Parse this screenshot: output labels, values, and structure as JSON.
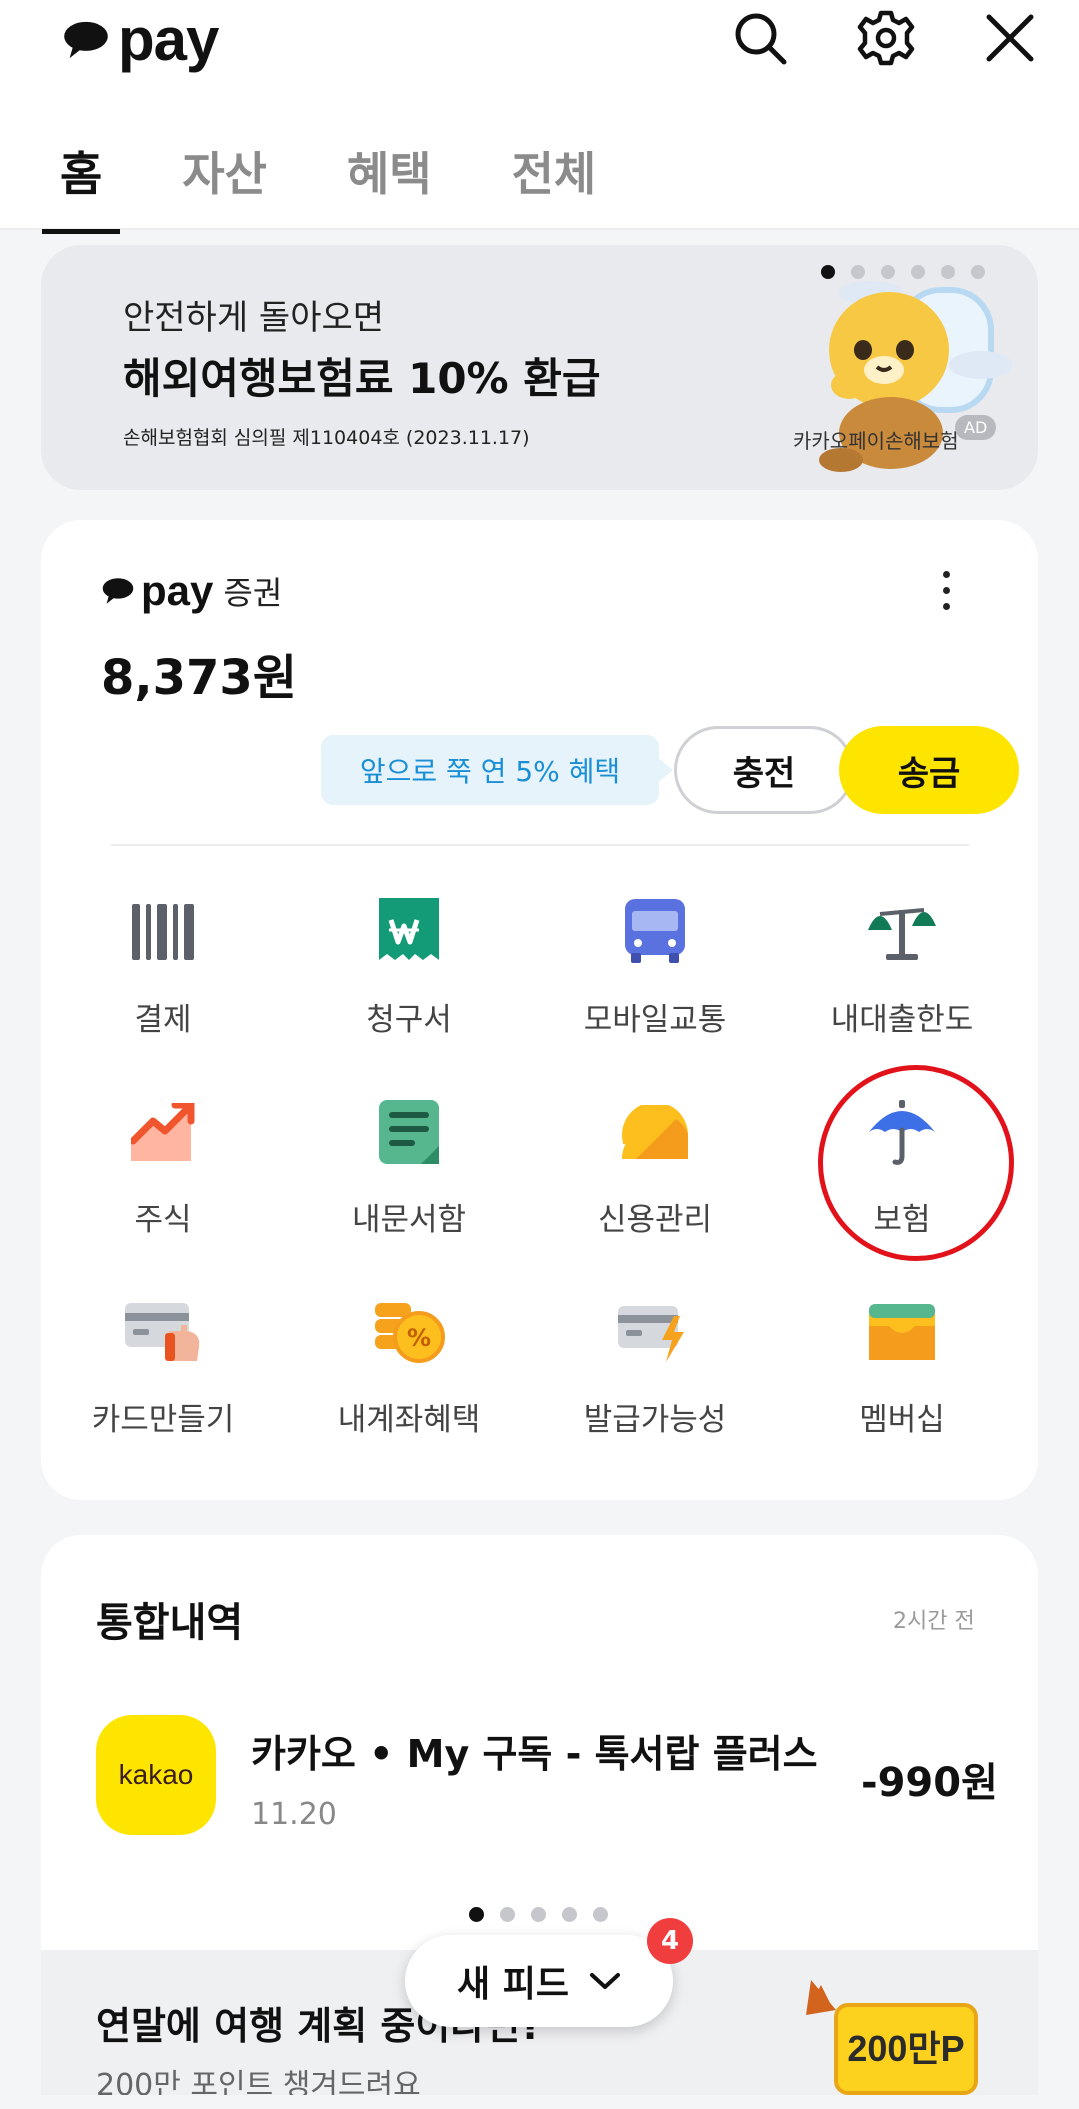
{
  "header": {
    "brand": "pay",
    "tabs": [
      {
        "label": "홈",
        "active": true
      },
      {
        "label": "자산",
        "active": false
      },
      {
        "label": "혜택",
        "active": false
      },
      {
        "label": "전체",
        "active": false
      }
    ],
    "icons": [
      "search-icon",
      "gear-icon",
      "close-icon"
    ]
  },
  "banner": {
    "subtitle": "안전하게 돌아오면",
    "title": "해외여행보험료 10% 환급",
    "fine_print": "손해보험협회 심의필 제110404호 (2023.11.17)",
    "brand": "카카오페이손해보험",
    "ad_label": "AD",
    "page_count": 6,
    "active_page": 1
  },
  "pay_card": {
    "brand_word": "pay",
    "brand_suffix": "증권",
    "balance": "8,373원",
    "promo_text": "앞으로 쭉 연 5% 혜택",
    "charge_label": "충전",
    "send_label": "송금",
    "menu": [
      {
        "label": "결제",
        "icon": "barcode-icon"
      },
      {
        "label": "청구서",
        "icon": "bill-icon"
      },
      {
        "label": "모바일교통",
        "icon": "bus-icon"
      },
      {
        "label": "내대출한도",
        "icon": "scale-icon"
      },
      {
        "label": "주식",
        "icon": "stock-chart-icon"
      },
      {
        "label": "내문서함",
        "icon": "document-icon"
      },
      {
        "label": "신용관리",
        "icon": "credit-gauge-icon"
      },
      {
        "label": "보험",
        "icon": "umbrella-icon"
      },
      {
        "label": "카드만들기",
        "icon": "card-hand-icon"
      },
      {
        "label": "내계좌혜택",
        "icon": "coin-percent-icon"
      },
      {
        "label": "발급가능성",
        "icon": "card-bolt-icon"
      },
      {
        "label": "멤버십",
        "icon": "wallet-icon"
      }
    ]
  },
  "history": {
    "title": "통합내역",
    "updated": "2시간 전",
    "item": {
      "logo_text": "kakao",
      "name": "카카오 • My 구독 - 톡서랍 플러스",
      "date": "11.20",
      "amount": "-990원"
    },
    "page_count": 5,
    "active_page": 1
  },
  "feed_promo": {
    "title": "연말에 여행 계획 중이라면?",
    "subtitle": "200만 포인트 챙겨드려요",
    "point_label": "200만P"
  },
  "new_feed": {
    "label": "새 피드",
    "badge": "4"
  },
  "colors": {
    "kakao_yellow": "#fee500",
    "promo_blue": "#1a8fd6",
    "badge_red": "#f03e3e",
    "annotation_red": "#e2121b"
  }
}
